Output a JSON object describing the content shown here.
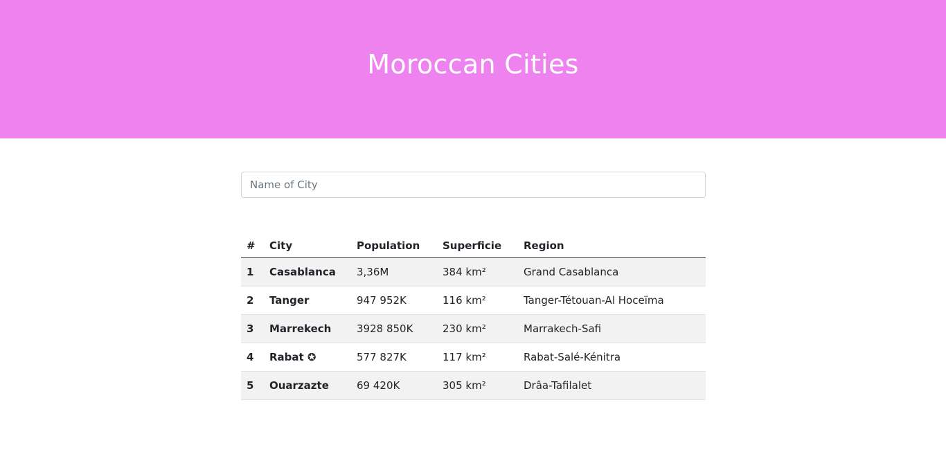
{
  "header": {
    "title": "Moroccan Cities",
    "background_color": "#ee82ee"
  },
  "search": {
    "placeholder": "Name of City",
    "value": ""
  },
  "table": {
    "columns": [
      "#",
      "City",
      "Population",
      "Superficie",
      "Region"
    ],
    "rows": [
      {
        "index": "1",
        "city": "Casablanca",
        "population": "3,36M",
        "superficie": "384 km²",
        "region": "Grand Casablanca"
      },
      {
        "index": "2",
        "city": "Tanger",
        "population": "947 952K",
        "superficie": "116 km²",
        "region": "Tanger-Tétouan-Al Hoceïma"
      },
      {
        "index": "3",
        "city": "Marrekech",
        "population": "3928 850K",
        "superficie": "230 km²",
        "region": "Marrakech-Safi"
      },
      {
        "index": "4",
        "city": "Rabat ✪",
        "population": "577 827K",
        "superficie": "117 km²",
        "region": "Rabat-Salé-Kénitra"
      },
      {
        "index": "5",
        "city": "Ouarzazte",
        "population": "69 420K",
        "superficie": "305 km²",
        "region": "Drâa-Tafilalet"
      }
    ]
  }
}
